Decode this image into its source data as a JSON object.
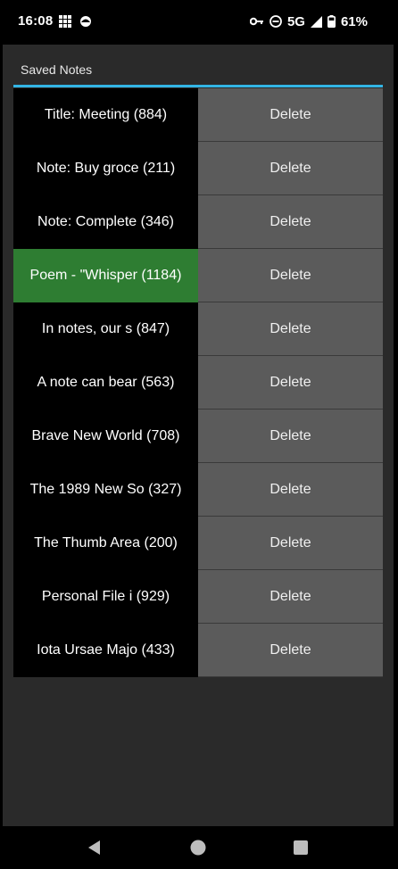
{
  "status_bar": {
    "time": "16:08",
    "network": "5G",
    "battery": "61%"
  },
  "dialog": {
    "title": "Saved Notes",
    "accent_color": "#33b5e5",
    "selected_color": "#2e7d32",
    "notes": [
      {
        "label": "Title: Meeting  (884)",
        "action": "Delete",
        "selected": false
      },
      {
        "label": "Note: Buy groce (211)",
        "action": "Delete",
        "selected": false
      },
      {
        "label": "Note: Complete  (346)",
        "action": "Delete",
        "selected": false
      },
      {
        "label": "Poem - \"Whisper (1184)",
        "action": "Delete",
        "selected": true
      },
      {
        "label": "In notes, our s (847)",
        "action": "Delete",
        "selected": false
      },
      {
        "label": "A note can bear (563)",
        "action": "Delete",
        "selected": false
      },
      {
        "label": "Brave New World (708)",
        "action": "Delete",
        "selected": false
      },
      {
        "label": "The 1989 New So (327)",
        "action": "Delete",
        "selected": false
      },
      {
        "label": "The Thumb Area  (200)",
        "action": "Delete",
        "selected": false
      },
      {
        "label": "Personal File i (929)",
        "action": "Delete",
        "selected": false
      },
      {
        "label": "Iota Ursae Majo (433)",
        "action": "Delete",
        "selected": false
      }
    ]
  },
  "nav_bar": {
    "icons": [
      "back-icon",
      "home-icon",
      "recents-icon"
    ]
  }
}
